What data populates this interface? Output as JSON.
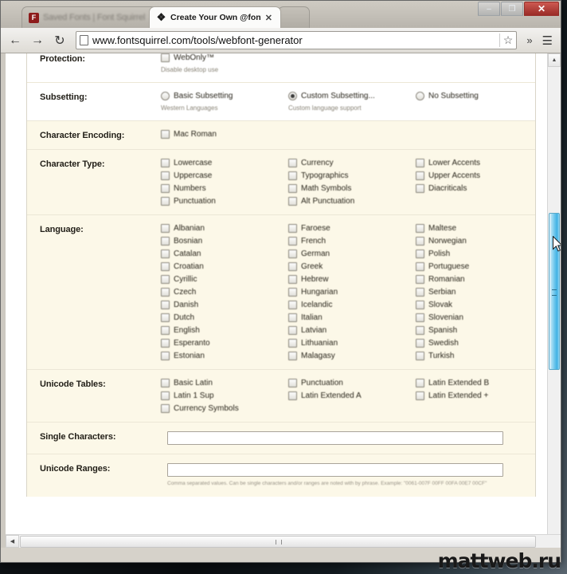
{
  "window": {
    "controls": {
      "minimize": "–",
      "maximize": "❐",
      "close": "✕"
    }
  },
  "tabs": [
    {
      "title": "Saved Fonts | Font Squirrel",
      "favicon": "font-squirrel-favicon",
      "active": false,
      "close_label": ""
    },
    {
      "title": "Create Your Own @font-f",
      "favicon": "font-page-favicon",
      "active": true,
      "close_label": "✕"
    }
  ],
  "toolbar": {
    "back": "←",
    "forward": "→",
    "reload": "↻",
    "url": "www.fontsquirrel.com/tools/webfont-generator",
    "star": "☆",
    "overflow": "»",
    "menu": "☰"
  },
  "form": {
    "rows": [
      {
        "label": "Protection:",
        "type": "checkbox",
        "columns": [
          {
            "options": [
              {
                "label": "WebOnly™",
                "checked": false,
                "hint": "Disable desktop use"
              }
            ]
          }
        ]
      },
      {
        "label": "Subsetting:",
        "type": "radio",
        "columns": [
          {
            "options": [
              {
                "label": "Basic Subsetting",
                "checked": false,
                "hint": "Western Languages"
              }
            ]
          },
          {
            "options": [
              {
                "label": "Custom Subsetting...",
                "checked": true,
                "hint": "Custom language support"
              }
            ]
          },
          {
            "options": [
              {
                "label": "No Subsetting",
                "checked": false,
                "hint": ""
              }
            ]
          }
        ]
      },
      {
        "label": "Character Encoding:",
        "type": "checkbox",
        "columns": [
          {
            "options": [
              {
                "label": "Mac Roman",
                "checked": false,
                "hint": ""
              }
            ]
          }
        ]
      },
      {
        "label": "Character Type:",
        "type": "checkbox",
        "columns": [
          {
            "options": [
              {
                "label": "Lowercase",
                "checked": false
              },
              {
                "label": "Uppercase",
                "checked": false
              },
              {
                "label": "Numbers",
                "checked": false
              },
              {
                "label": "Punctuation",
                "checked": false
              }
            ]
          },
          {
            "options": [
              {
                "label": "Currency",
                "checked": false
              },
              {
                "label": "Typographics",
                "checked": false
              },
              {
                "label": "Math Symbols",
                "checked": false
              },
              {
                "label": "Alt Punctuation",
                "checked": false
              }
            ]
          },
          {
            "options": [
              {
                "label": "Lower Accents",
                "checked": false
              },
              {
                "label": "Upper Accents",
                "checked": false
              },
              {
                "label": "Diacriticals",
                "checked": false
              }
            ]
          }
        ]
      },
      {
        "label": "Language:",
        "type": "checkbox",
        "columns": [
          {
            "options": [
              {
                "label": "Albanian",
                "checked": false
              },
              {
                "label": "Bosnian",
                "checked": false
              },
              {
                "label": "Catalan",
                "checked": false
              },
              {
                "label": "Croatian",
                "checked": false
              },
              {
                "label": "Cyrillic",
                "checked": false
              },
              {
                "label": "Czech",
                "checked": false
              },
              {
                "label": "Danish",
                "checked": false
              },
              {
                "label": "Dutch",
                "checked": false
              },
              {
                "label": "English",
                "checked": false
              },
              {
                "label": "Esperanto",
                "checked": false
              },
              {
                "label": "Estonian",
                "checked": false
              }
            ]
          },
          {
            "options": [
              {
                "label": "Faroese",
                "checked": false
              },
              {
                "label": "French",
                "checked": false
              },
              {
                "label": "German",
                "checked": false
              },
              {
                "label": "Greek",
                "checked": false
              },
              {
                "label": "Hebrew",
                "checked": false
              },
              {
                "label": "Hungarian",
                "checked": false
              },
              {
                "label": "Icelandic",
                "checked": false
              },
              {
                "label": "Italian",
                "checked": false
              },
              {
                "label": "Latvian",
                "checked": false
              },
              {
                "label": "Lithuanian",
                "checked": false
              },
              {
                "label": "Malagasy",
                "checked": false
              }
            ]
          },
          {
            "options": [
              {
                "label": "Maltese",
                "checked": false
              },
              {
                "label": "Norwegian",
                "checked": false
              },
              {
                "label": "Polish",
                "checked": false
              },
              {
                "label": "Portuguese",
                "checked": false
              },
              {
                "label": "Romanian",
                "checked": false
              },
              {
                "label": "Serbian",
                "checked": false
              },
              {
                "label": "Slovak",
                "checked": false
              },
              {
                "label": "Slovenian",
                "checked": false
              },
              {
                "label": "Spanish",
                "checked": false
              },
              {
                "label": "Swedish",
                "checked": false
              },
              {
                "label": "Turkish",
                "checked": false
              }
            ]
          }
        ]
      },
      {
        "label": "Unicode Tables:",
        "type": "checkbox",
        "columns": [
          {
            "options": [
              {
                "label": "Basic Latin",
                "checked": false
              },
              {
                "label": "Latin 1 Sup",
                "checked": false
              },
              {
                "label": "Currency Symbols",
                "checked": false
              }
            ]
          },
          {
            "options": [
              {
                "label": "Punctuation",
                "checked": false
              },
              {
                "label": "Latin Extended A",
                "checked": false
              }
            ]
          },
          {
            "options": [
              {
                "label": "Latin Extended B",
                "checked": false
              },
              {
                "label": "Latin Extended +",
                "checked": false
              }
            ]
          }
        ]
      }
    ],
    "single_characters": {
      "label": "Single Characters:",
      "value": "",
      "placeholder": ""
    },
    "unicode_ranges": {
      "label": "Unicode Ranges:",
      "value": "",
      "placeholder": "",
      "help": "Comma separated values. Can be single characters and/or ranges are noted with by phrase. Example: \"0061-007F 00FF 00FA 00E7 00CF\""
    }
  },
  "scrollbars": {
    "vertical": {
      "up": "▲",
      "down": "▼",
      "thumb_state": "active"
    },
    "horizontal": {
      "left": "◀",
      "right": "▶"
    }
  },
  "watermark": "mattweb.ru"
}
